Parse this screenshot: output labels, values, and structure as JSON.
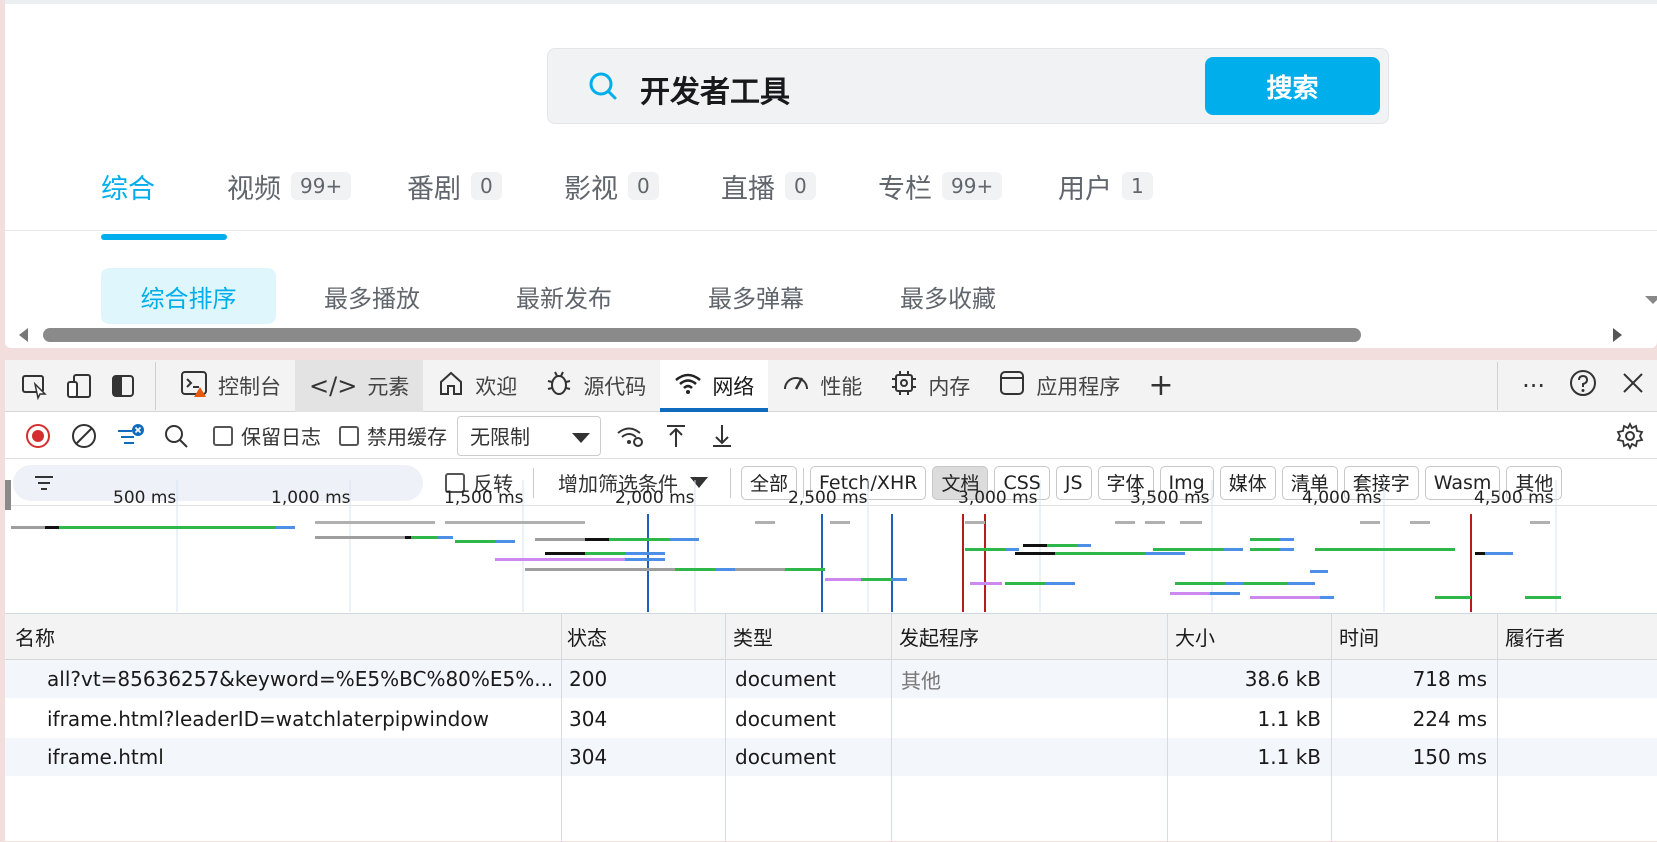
{
  "search": {
    "query": "开发者工具",
    "button": "搜索"
  },
  "tabs": [
    {
      "label": "综合",
      "count": ""
    },
    {
      "label": "视频",
      "count": "99+"
    },
    {
      "label": "番剧",
      "count": "0"
    },
    {
      "label": "影视",
      "count": "0"
    },
    {
      "label": "直播",
      "count": "0"
    },
    {
      "label": "专栏",
      "count": "99+"
    },
    {
      "label": "用户",
      "count": "1"
    }
  ],
  "sorts": [
    "综合排序",
    "最多播放",
    "最新发布",
    "最多弹幕",
    "最多收藏"
  ],
  "devtools": {
    "tabs": [
      {
        "label": "控制台",
        "icon": "console-icon"
      },
      {
        "label": "元素",
        "icon": "code-icon"
      },
      {
        "label": "欢迎",
        "icon": "home-icon"
      },
      {
        "label": "源代码",
        "icon": "bug-icon"
      },
      {
        "label": "网络",
        "icon": "wifi-icon"
      },
      {
        "label": "性能",
        "icon": "gauge-icon"
      },
      {
        "label": "内存",
        "icon": "chip-icon"
      },
      {
        "label": "应用程序",
        "icon": "app-icon"
      }
    ],
    "toolbar": {
      "preserve_log": "保留日志",
      "disable_cache": "禁用缓存",
      "throttle": "无限制"
    },
    "filter": {
      "invert": "反转",
      "add_filter": "增加筛选条件"
    },
    "types": [
      "全部",
      "Fetch/XHR",
      "文档",
      "CSS",
      "JS",
      "字体",
      "Img",
      "媒体",
      "清单",
      "套接字",
      "Wasm",
      "其他"
    ],
    "timeline_ticks": [
      "500 ms",
      "1,000 ms",
      "1,500 ms",
      "2,000 ms",
      "2,500 ms",
      "3,000 ms",
      "3,500 ms",
      "4,000 ms",
      "4,500 ms"
    ],
    "columns": [
      "名称",
      "状态",
      "类型",
      "发起程序",
      "大小",
      "时间",
      "履行者"
    ],
    "rows": [
      {
        "name": "all?vt=85636257&keyword=%E5%BC%80%E5%...",
        "status": "200",
        "type": "document",
        "initiator": "其他",
        "size": "38.6 kB",
        "time": "718 ms"
      },
      {
        "name": "iframe.html?leaderID=watchlaterpipwindow",
        "status": "304",
        "type": "document",
        "initiator": "",
        "size": "1.1 kB",
        "time": "224 ms"
      },
      {
        "name": "iframe.html",
        "status": "304",
        "type": "document",
        "initiator": "",
        "size": "1.1 kB",
        "time": "150 ms"
      }
    ]
  }
}
